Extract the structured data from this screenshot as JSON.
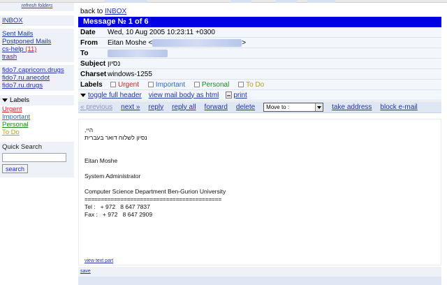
{
  "sidebar": {
    "refresh": "refresh folders",
    "inbox": "INBOX",
    "folders": [
      {
        "label": "Sent Mails",
        "count": ""
      },
      {
        "label": "Postponed Mails",
        "count": ""
      },
      {
        "label": "cs-help",
        "count": "(11)"
      },
      {
        "label": "trash",
        "count": ""
      }
    ],
    "newsgroups": [
      "fido7.capricorn.drugs",
      "fido7.ru.anecdot",
      "fido7.ru.drugs"
    ],
    "labels_heading": "Labels",
    "labels": [
      {
        "label": "Urgent",
        "color": "#cc2222"
      },
      {
        "label": "Important",
        "color": "#2a6acc"
      },
      {
        "label": "Personal",
        "color": "#1b8a1b"
      },
      {
        "label": "To Do",
        "color": "#b8a20a"
      }
    ],
    "quick_search": {
      "title": "Quick Search",
      "value": "",
      "button": "search"
    }
  },
  "main": {
    "back_prefix": "back to ",
    "back_link": "INBOX",
    "message_title": "Message № 1 of 6",
    "headers": {
      "date_label": "Date",
      "date_value": "Wed, 10 Aug 2005 10:23:11 +0300",
      "from_label": "From",
      "from_name": "Eitan Moshe <",
      "from_suffix": ">",
      "to_label": "To",
      "subject_label": "Subject",
      "subject_value": "נסיון",
      "charset_label": "Charset",
      "charset_value": "windows-1255",
      "labels_label": "Labels"
    },
    "label_checks": [
      "Urgent",
      "Important",
      "Personal",
      "To Do"
    ],
    "tools": {
      "toggle": "toggle full header",
      "view_html": "view mail body as html",
      "print": "print"
    },
    "nav": {
      "previous": "« previous",
      "next": "next »",
      "reply": "reply",
      "reply_all": "reply all",
      "forward": "forward",
      "delete": "delete",
      "move_to": "Move to :",
      "take_address": "take address",
      "block": "block e-mail"
    },
    "body": {
      "line1": "היי,",
      "line2": "נסיון לשלוח דואר בעברית",
      "sig_name": "Eitan Moshe",
      "sig_title": "System Administrator",
      "sig_dept": "Computer Science Department Ben-Gurion University",
      "sig_rule": "==========================================",
      "tel": "Tel :   + 972   8 647 7837",
      "fax": "Fax :   + 972   8 647 2909"
    },
    "view_text_part": "view text part",
    "save": "save"
  }
}
